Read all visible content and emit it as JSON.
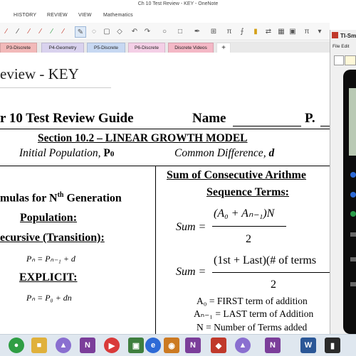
{
  "window": {
    "title": "Ch 10 Test Review - KEY - OneNote"
  },
  "menu": {
    "items": [
      "HISTORY",
      "REVIEW",
      "VIEW",
      "Mathematics"
    ]
  },
  "section_tabs": [
    {
      "label": "P3-Discrete",
      "color": "#f2b9b9"
    },
    {
      "label": "P4-Geometry",
      "color": "#d9d2ee"
    },
    {
      "label": "P5-Discrete",
      "color": "#c7d8f2"
    },
    {
      "label": "P6-Discrete",
      "color": "#f4cfe6"
    },
    {
      "label": "Discrete Videos",
      "color": "#f4b8c6"
    },
    {
      "label": "+",
      "color": "#ffffff"
    }
  ],
  "page": {
    "title": "eview - KEY",
    "heading": "r 10 Test Review Guide",
    "name_label": "Name",
    "p_label": "P.",
    "section_title": "Section 10.2 – LINEAR GROWTH MODEL",
    "initial_population": "Initial Population,",
    "initial_population_symbol": "P",
    "initial_population_sub": "0",
    "common_difference": "Common Difference,",
    "common_difference_symbol": "d",
    "left": {
      "formulas_heading": "mulas for N",
      "formulas_sup": "th",
      "formulas_tail": "Generation",
      "population": "Population",
      "recursive": "ecursive (Transition):",
      "recursive_formula": "Pₙ = Pₙ₋₁ + d",
      "explicit": "EXPLICIT:",
      "explicit_formula": "Pₙ = P₀ + dn"
    },
    "right": {
      "heading_line1": "Sum of Consecutive Arithme",
      "heading_line2": "Sequence Terms:",
      "sum_label": "Sum =",
      "formula1_numerator": "(A₀ + Aₙ₋₁)N",
      "formula1_denominator": "2",
      "formula2_numerator": "(1st + Last)(#  of terms",
      "formula2_denominator": "2",
      "def_a0": "A₀ = FIRST term of addition",
      "def_an": "Aₙ₋₁ = LAST term of Addition",
      "def_n": "N = Number of Terms added"
    }
  },
  "ti_window": {
    "title": "TI-Sm",
    "menu": "File  Edit"
  },
  "taskbar": {
    "apps": [
      {
        "icon": "chrome-icon",
        "color": "#2f9e44"
      },
      {
        "icon": "folder-icon",
        "color": "#e0b13c"
      },
      {
        "icon": "geogebra-icon",
        "color": "#8a6fd0"
      },
      {
        "icon": "onenote-icon",
        "color": "#7b3e9a",
        "glyph": "N"
      },
      {
        "icon": "media-icon",
        "color": "#d93a3a"
      },
      {
        "icon": "calculator-icon",
        "color": "#3f7f3f"
      },
      {
        "icon": "explorer-icon",
        "color": "#2d6ad6"
      },
      {
        "icon": "app-icon",
        "color": "#cc7a22"
      },
      {
        "icon": "onenote-icon-2",
        "color": "#7b3e9a",
        "glyph": "N"
      },
      {
        "icon": "ti-icon",
        "color": "#c0392b"
      },
      {
        "icon": "geogebra-icon-2",
        "color": "#8a6fd0"
      },
      {
        "icon": "onenote-icon-3",
        "color": "#7b3e9a",
        "glyph": "N"
      },
      {
        "icon": "word-icon",
        "color": "#2b5797",
        "glyph": "W"
      },
      {
        "icon": "ti-icon-2",
        "color": "#2a2a2a"
      }
    ]
  }
}
